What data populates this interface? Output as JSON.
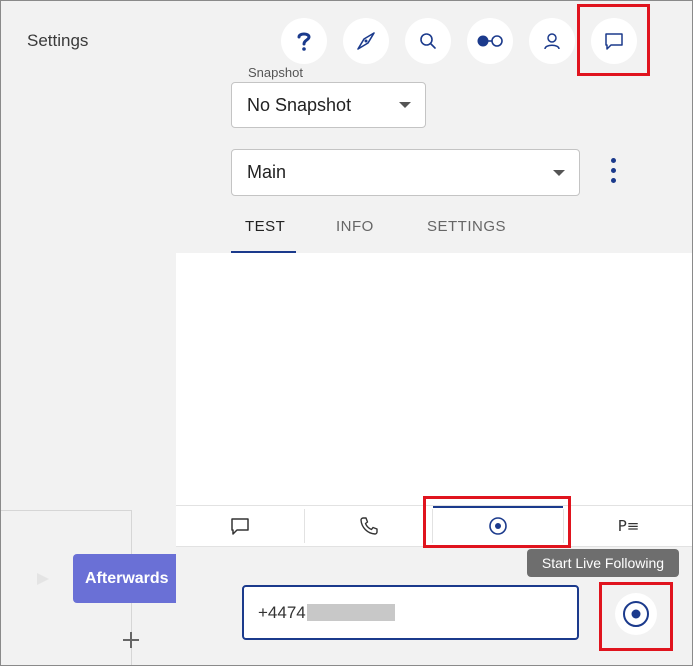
{
  "sidebar": {
    "settings_label": "Settings"
  },
  "canvas": {
    "node_label": "Afterwards"
  },
  "header": {
    "icons": [
      "help-icon",
      "compass-icon",
      "search-icon",
      "toggle-icon",
      "user-icon",
      "chat-icon"
    ]
  },
  "snapshot": {
    "label": "Snapshot",
    "value": "No Snapshot"
  },
  "branch": {
    "value": "Main"
  },
  "tabs": [
    {
      "label": "TEST",
      "active": true
    },
    {
      "label": "INFO",
      "active": false
    },
    {
      "label": "SETTINGS",
      "active": false
    }
  ],
  "bottom_tabs": {
    "chat": "chat-icon",
    "phone": "phone-icon",
    "live": "live-follow-icon",
    "list_label": "P≡"
  },
  "tooltip": {
    "text": "Start Live Following"
  },
  "phone": {
    "value": "+4474"
  },
  "colors": {
    "accent": "#1b3a8c",
    "node": "#6a70d6",
    "highlight": "#e0141e",
    "tooltip": "#6e6e6e"
  }
}
